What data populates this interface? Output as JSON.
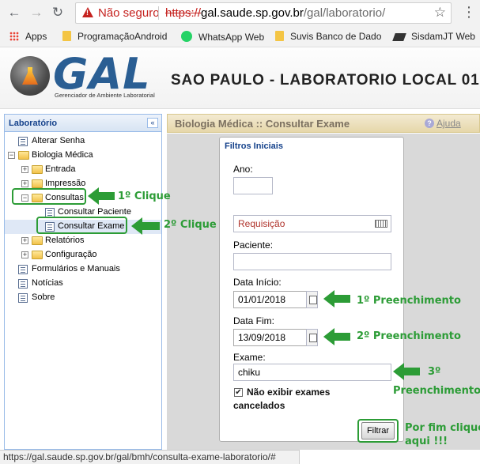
{
  "browser": {
    "insecure_label": "Não seguro",
    "url_proto": "https://",
    "url_host": "gal.saude.sp.gov.br",
    "url_path": "/gal/laboratorio/",
    "bookmarks": [
      {
        "label": "Apps",
        "icon": "apps-grid-icon"
      },
      {
        "label": "ProgramaçãoAndroid",
        "icon": "folder-icon"
      },
      {
        "label": "WhatsApp Web",
        "icon": "whatsapp-icon"
      },
      {
        "label": "Suvis Banco de Dado",
        "icon": "folder-icon"
      },
      {
        "label": "SisdamJT Web",
        "icon": "sisdam-icon"
      }
    ]
  },
  "header": {
    "logo_text": "GAL",
    "logo_subtitle": "Gerenciador de Ambiente Laboratorial",
    "lab_title": "SAO PAULO - LABORATORIO LOCAL 01"
  },
  "sidebar": {
    "title": "Laboratório",
    "collapse_symbol": "«",
    "nodes": [
      {
        "label": "Alterar Senha"
      },
      {
        "label": "Biologia Médica"
      },
      {
        "label": "Entrada"
      },
      {
        "label": "Impressão"
      },
      {
        "label": "Consultas"
      },
      {
        "label": "Consultar Paciente"
      },
      {
        "label": "Consultar Exame"
      },
      {
        "label": "Relatórios"
      },
      {
        "label": "Configuração"
      },
      {
        "label": "Formulários e Manuais"
      },
      {
        "label": "Notícias"
      },
      {
        "label": "Sobre"
      }
    ]
  },
  "main": {
    "title": "Biologia Médica :: Consultar Exame",
    "help_label": "Ajuda",
    "form": {
      "legend": "Filtros Iniciais",
      "ano_label": "Ano:",
      "ano_value": "",
      "requisicao_placeholder": "Requisição",
      "paciente_label": "Paciente:",
      "paciente_value": "",
      "data_inicio_label": "Data Início:",
      "data_inicio_value": "01/01/2018",
      "data_fim_label": "Data Fim:",
      "data_fim_value": "13/09/2018",
      "exame_label": "Exame:",
      "exame_value": "chiku",
      "checkbox_checked": true,
      "checkbox_label": "Não exibir exames cancelados",
      "filtrar_label": "Filtrar"
    }
  },
  "annotations": {
    "step1": "1º Clique",
    "step2": "2º Clique",
    "fill1": "1º Preenchimento",
    "fill2": "2º Preenchimento",
    "fill3_line1": "3º",
    "fill3_line2": "Preenchimento",
    "final_line1": "Por fim clique",
    "final_line2": "aqui !!!",
    "color": "#2c9c36"
  },
  "statusbar": {
    "url": "https://gal.saude.sp.gov.br/gal/bmh/consulta-exame-laboratorio/#"
  }
}
